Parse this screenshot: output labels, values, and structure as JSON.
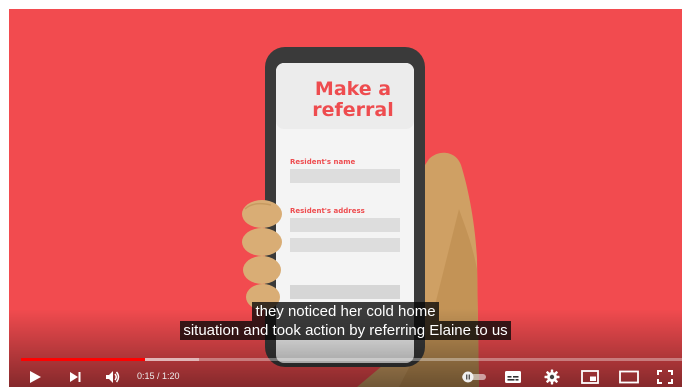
{
  "video": {
    "screen_title_line1": "Make a",
    "screen_title_line2": "referral",
    "field1_label": "Resident's name",
    "field2_label": "Resident's address"
  },
  "captions": {
    "line1": "they noticed her cold home",
    "line2": "situation and took action by referring Elaine to us"
  },
  "player": {
    "time_display": "0:15 / 1:20",
    "progress_fraction": 0.1875,
    "buffered_fraction": 0.27,
    "colors": {
      "background": "#f24b4f",
      "accent": "#ee4c4f",
      "progress": "#ff0000"
    }
  },
  "icons": {
    "play": "play-icon",
    "next": "next-icon",
    "volume": "volume-icon",
    "autoplay": "autoplay-toggle-icon",
    "subtitles": "subtitles-icon",
    "settings": "gear-icon",
    "miniplayer": "miniplayer-icon",
    "theater": "theater-mode-icon",
    "fullscreen": "fullscreen-icon"
  }
}
